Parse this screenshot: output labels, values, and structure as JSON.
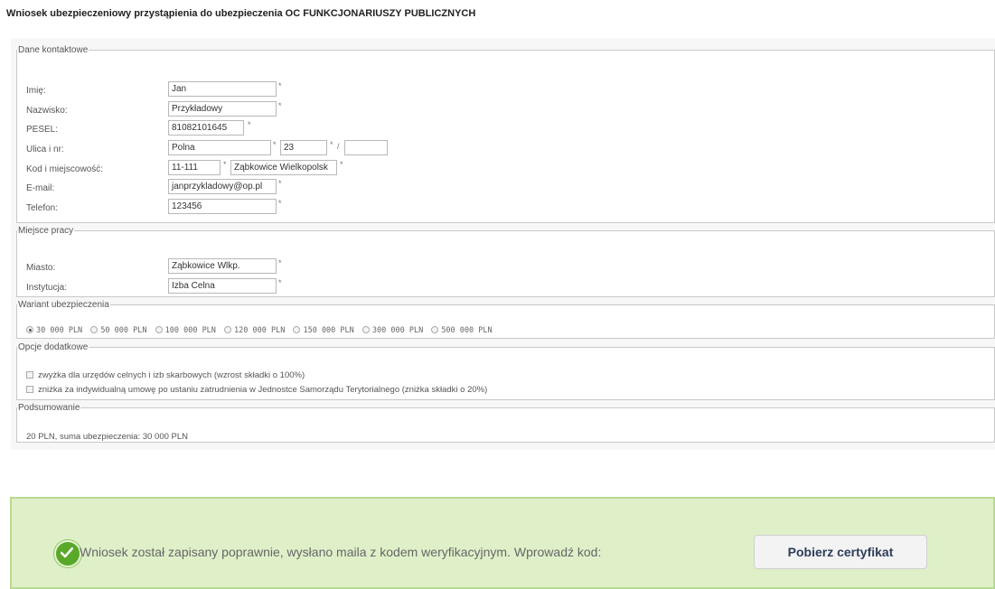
{
  "page_title": "Wniosek ubezpieczeniowy przystąpienia do ubezpieczenia OC FUNKCJONARIUSZY PUBLICZNYCH",
  "required_mark": "*",
  "slash": "/",
  "contact": {
    "legend": "Dane kontaktowe",
    "first_name_label": "Imię:",
    "first_name_value": "Jan",
    "last_name_label": "Nazwisko:",
    "last_name_value": "Przykładowy",
    "pesel_label": "PESEL:",
    "pesel_value": "81082101645",
    "street_label": "Ulica i nr:",
    "street_value": "Polna",
    "house_number_value": "23",
    "apartment_value": "",
    "postal_label": "Kod i miejscowość:",
    "postal_value": "11-111",
    "city_value": "Ząbkowice Wielkopolsk",
    "email_label": "E-mail:",
    "email_value": "janprzykladowy@op.pl",
    "phone_label": "Telefon:",
    "phone_value": "123456"
  },
  "workplace": {
    "legend": "Miejsce pracy",
    "city_label": "Miasto:",
    "city_value": "Ząbkowice Wlkp.",
    "institution_label": "Instytucja:",
    "institution_value": "Izba Celna"
  },
  "variant": {
    "legend": "Wariant ubezpieczenia",
    "options": [
      "30 000 PLN",
      "50 000 PLN",
      "100 000 PLN",
      "120 000 PLN",
      "150 000 PLN",
      "300 000 PLN",
      "500 000 PLN"
    ],
    "selected": "30 000 PLN"
  },
  "additional": {
    "legend": "Opcje dodatkowe",
    "option1": "zwyżka dla urzędów celnych i izb skarbowych (wzrost składki o 100%)",
    "option2": "zniżka za indywidualną umowę po ustaniu zatrudnienia w Jednostce Samorządu Terytorialnego (zniżka składki o 20%)"
  },
  "summary": {
    "legend": "Podsumowanie",
    "text": "20 PLN, suma ubezpieczenia: 30 000 PLN"
  },
  "success": {
    "message": "Wniosek został zapisany poprawnie, wysłano maila z kodem weryfikacyjnym. Wprowadź kod:",
    "button_label": "Pobierz certyfikat",
    "icon": "checkmark-icon",
    "accent_color": "#5aa829",
    "background_color": "#dff0c9"
  }
}
